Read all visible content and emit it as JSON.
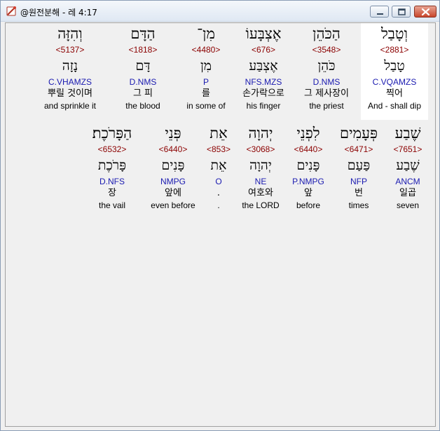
{
  "window": {
    "title": "@원전분해 - 레 4:17"
  },
  "icons": {
    "app": "app-icon",
    "minimize": "minimize-icon",
    "maximize": "maximize-icon",
    "close": "close-icon"
  },
  "colors": {
    "strong": "#8b0000",
    "parse": "#1a1ab0",
    "selected_bg": "#ffffff"
  },
  "rows": [
    {
      "words": [
        {
          "hebrew": "וְטָבַל",
          "strong": "<2881>",
          "lemma": "טָבַל",
          "parse": "C.VQAMZS",
          "korean": "찍어",
          "english": "And - shall dip",
          "selected": true
        },
        {
          "hebrew": "הַכֹּהֵן",
          "strong": "<3548>",
          "lemma": "כֹּהֵן",
          "parse": "D.NMS",
          "korean": "그 제사장이",
          "english": "the priest"
        },
        {
          "hebrew": "אֶצְבָּעוֹ",
          "strong": "<676>",
          "lemma": "אֶצְבַּע",
          "parse": "NFS.MZS",
          "korean": "손가락으로",
          "english": "his finger"
        },
        {
          "hebrew": "מִן־",
          "strong": "<4480>",
          "lemma": "מִן",
          "parse": "P",
          "korean": "를",
          "english": "in some of"
        },
        {
          "hebrew": "הַדָּם",
          "strong": "<1818>",
          "lemma": "דָּם",
          "parse": "D.NMS",
          "korean": "그 피",
          "english": "the blood"
        },
        {
          "hebrew": "וְהִזָּה",
          "strong": "<5137>",
          "lemma": "נָזָה",
          "parse": "C.VHAMZS",
          "korean": "뿌릴 것이며",
          "english": "and sprinkle it"
        }
      ]
    },
    {
      "words": [
        {
          "hebrew": "שֶׁבַע",
          "strong": "<7651>",
          "lemma": "שֶׁבַע",
          "parse": "ANCM",
          "korean": "일곱",
          "english": "seven"
        },
        {
          "hebrew": "פְּעָמִים",
          "strong": "<6471>",
          "lemma": "פַּעַם",
          "parse": "NFP",
          "korean": "번",
          "english": "times"
        },
        {
          "hebrew": "לִפְנֵי",
          "strong": "<6440>",
          "lemma": "פָּנִים",
          "parse": "P.NMPG",
          "korean": "앞",
          "english": "before"
        },
        {
          "hebrew": "יְהוָה",
          "strong": "<3068>",
          "lemma": "יְהוָה",
          "parse": "NE",
          "korean": "여호와",
          "english": "the LORD"
        },
        {
          "hebrew": "אֵת",
          "strong": "<853>",
          "lemma": "אֵת",
          "parse": "O",
          "korean": ".",
          "english": "."
        },
        {
          "hebrew": "פְּנֵי",
          "strong": "<6440>",
          "lemma": "פָּנִים",
          "parse": "NMPG",
          "korean": "앞에",
          "english": "even before"
        },
        {
          "hebrew": "הַפָּרֹכֶת׃",
          "strong": "<6532>",
          "lemma": "פָּרֹכֶת",
          "parse": "D.NFS",
          "korean": "장",
          "english": "the vail"
        }
      ]
    }
  ]
}
